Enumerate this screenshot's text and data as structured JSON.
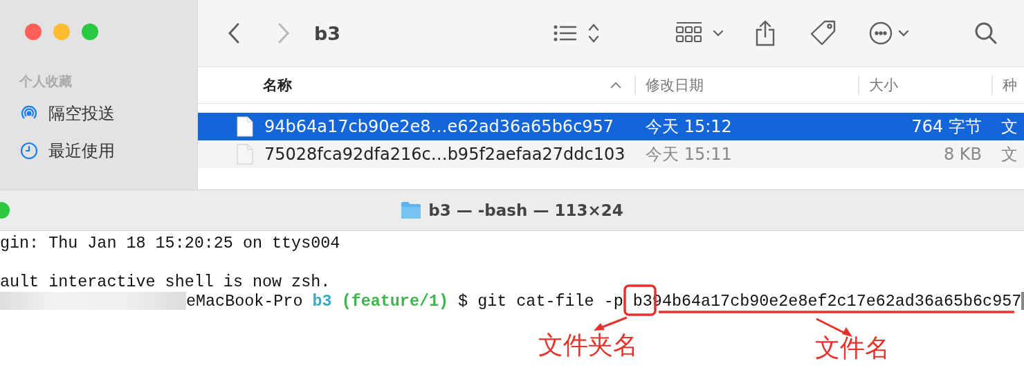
{
  "finder": {
    "title": "b3",
    "sidebar": {
      "section": "个人收藏",
      "items": [
        {
          "label": "隔空投送"
        },
        {
          "label": "最近使用"
        }
      ]
    },
    "columns": [
      {
        "label": "名称",
        "sorted": true
      },
      {
        "label": "修改日期",
        "sorted": false
      },
      {
        "label": "大小",
        "sorted": false
      },
      {
        "label": "种",
        "sorted": false
      }
    ],
    "rows": [
      {
        "name": "94b64a17cb90e2e8…e62ad36a65b6c957",
        "date": "今天 15:12",
        "size": "764 字节",
        "kind": "文",
        "selected": true
      },
      {
        "name": "75028fca92dfa216c…b95f2aefaa27ddc103",
        "date": "今天 15:11",
        "size": "8 KB",
        "kind": "文",
        "selected": false
      }
    ]
  },
  "terminal": {
    "title": "b3 — -bash — 113×24",
    "lines": [
      {
        "kind": "text",
        "text": "gin: Thu Jan 18 15:20:25 on ttys004"
      },
      {
        "kind": "blank"
      },
      {
        "kind": "text",
        "text": "ault interactive shell is now zsh."
      },
      {
        "kind": "prompt",
        "host": "eMacBook-Pro",
        "dir": "b3",
        "branch": "(feature/1)",
        "symbol": "$",
        "command": "git cat-file -p",
        "arg_dir": "b3",
        "arg_file": "94b64a17cb90e2e8ef2c17e62ad36a65b6c957"
      }
    ]
  },
  "annotations": [
    {
      "label": "文件夹名"
    },
    {
      "label": "文件名"
    }
  ]
}
